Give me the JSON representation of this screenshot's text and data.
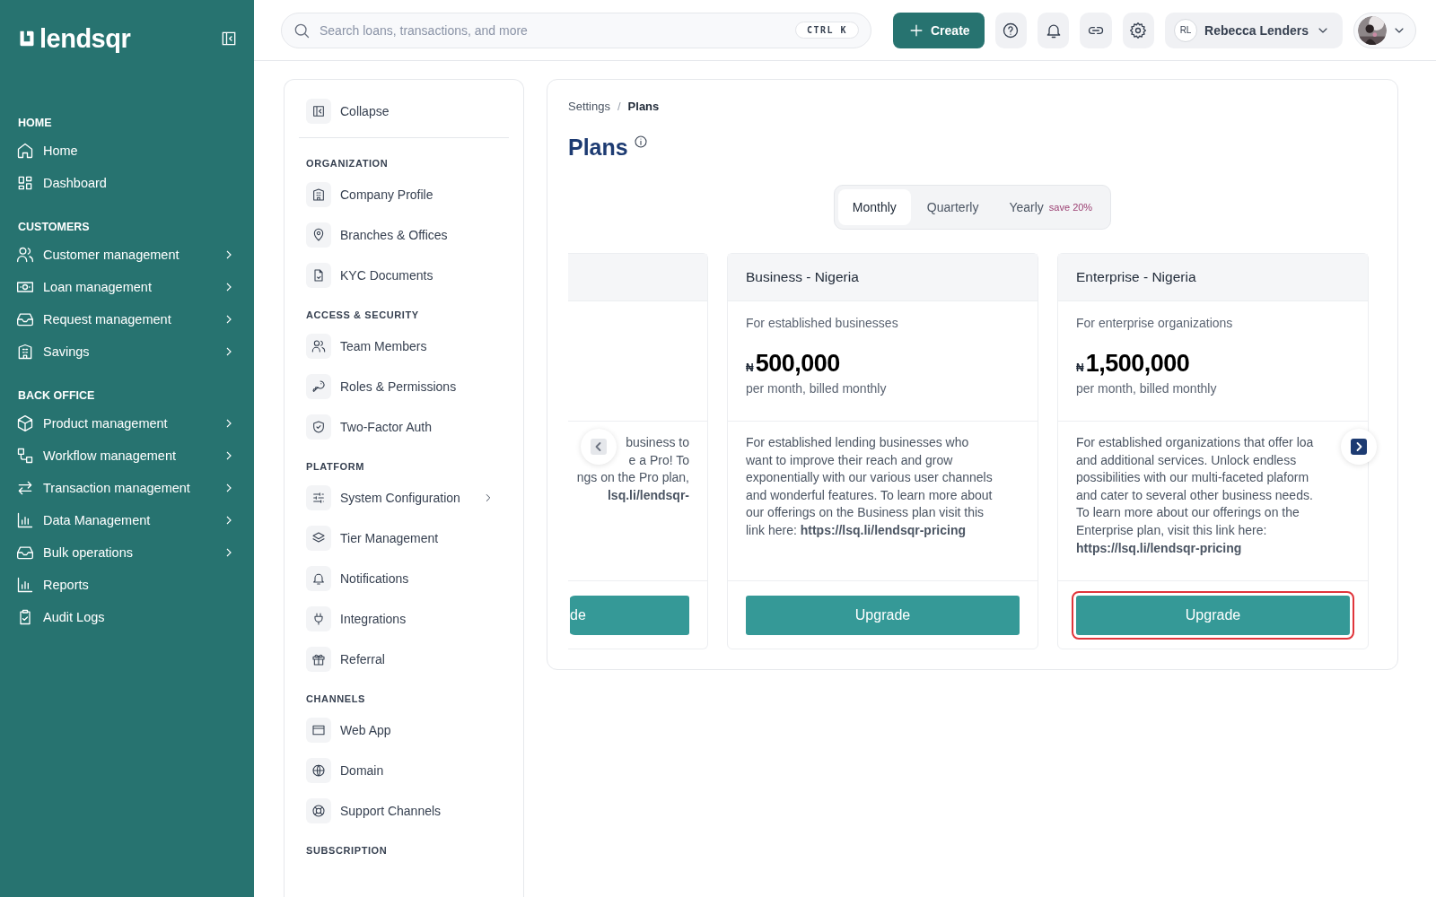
{
  "sidebar": {
    "logo": "lendsqr",
    "sections": [
      {
        "heading": "HOME",
        "items": [
          {
            "label": "Home",
            "expandable": false
          },
          {
            "label": "Dashboard",
            "expandable": false
          }
        ]
      },
      {
        "heading": "CUSTOMERS",
        "items": [
          {
            "label": "Customer management",
            "expandable": true
          },
          {
            "label": "Loan management",
            "expandable": true
          },
          {
            "label": "Request management",
            "expandable": true
          },
          {
            "label": "Savings",
            "expandable": true
          }
        ]
      },
      {
        "heading": "BACK OFFICE",
        "items": [
          {
            "label": "Product management",
            "expandable": true
          },
          {
            "label": "Workflow management",
            "expandable": true
          },
          {
            "label": "Transaction management",
            "expandable": true
          },
          {
            "label": "Data Management",
            "expandable": true
          },
          {
            "label": "Bulk operations",
            "expandable": true
          },
          {
            "label": "Reports",
            "expandable": false
          },
          {
            "label": "Audit Logs",
            "expandable": false
          }
        ]
      }
    ]
  },
  "topbar": {
    "search": {
      "placeholder": "Search loans, transactions, and more",
      "shortcut": "CTRL K"
    },
    "create_button": "Create",
    "user": {
      "initials": "RL",
      "name": "Rebecca Lenders"
    }
  },
  "settings_menu": {
    "collapse": "Collapse",
    "sections": [
      {
        "heading": "ORGANIZATION",
        "items": [
          {
            "label": "Company Profile",
            "expandable": false
          },
          {
            "label": "Branches & Offices",
            "expandable": false
          },
          {
            "label": "KYC Documents",
            "expandable": false
          }
        ]
      },
      {
        "heading": "ACCESS & SECURITY",
        "items": [
          {
            "label": "Team Members",
            "expandable": false
          },
          {
            "label": "Roles & Permissions",
            "expandable": false
          },
          {
            "label": "Two-Factor Auth",
            "expandable": false
          }
        ]
      },
      {
        "heading": "PLATFORM",
        "items": [
          {
            "label": "System Configuration",
            "expandable": true
          },
          {
            "label": "Tier Management",
            "expandable": false
          },
          {
            "label": "Notifications",
            "expandable": false
          },
          {
            "label": "Integrations",
            "expandable": false
          },
          {
            "label": "Referral",
            "expandable": false
          }
        ]
      },
      {
        "heading": "CHANNELS",
        "items": [
          {
            "label": "Web App",
            "expandable": false
          },
          {
            "label": "Domain",
            "expandable": false
          },
          {
            "label": "Support Channels",
            "expandable": false
          }
        ]
      },
      {
        "heading": "SUBSCRIPTION"
      }
    ]
  },
  "main": {
    "breadcrumb": [
      "Settings",
      "Plans"
    ],
    "breadcrumb_separator": "/",
    "title": "Plans",
    "billing_tabs": [
      {
        "label": "Monthly",
        "selected": true
      },
      {
        "label": "Quarterly",
        "selected": false
      },
      {
        "label": "Yearly",
        "badge": "save 20%",
        "selected": false
      }
    ],
    "carousel": {
      "prev_disabled": true,
      "next_disabled": false
    },
    "plans": [
      {
        "kind": "partial",
        "lines": [
          "business to",
          "e a Pro! To",
          "ngs on the Pro plan,",
          "**lsq.li/lendsqr-**"
        ],
        "button": "de",
        "focused": false
      },
      {
        "kind": "full",
        "name": "Business - Nigeria",
        "subtitle": "For established businesses",
        "currency": "₦",
        "price": "500,000",
        "period": "per month, billed monthly",
        "description": "For established lending businesses who want to improve their reach and grow exponentially with our various user channels and wonderful features. To learn more about our offerings on the Business plan visit this link here: **https://lsq.li/lendsqr-pricing**",
        "button": "Upgrade",
        "focused": false
      },
      {
        "kind": "full",
        "name": "Enterprise - Nigeria",
        "subtitle": "For enterprise organizations",
        "currency": "₦",
        "price": "1,500,000",
        "period": "per month, billed monthly",
        "description": "For established organizations that offer loa and additional services. Unlock endless possibilities with our multi-faceted plaform and cater to several other business needs. To learn more about our offerings on the Enterprise plan, visit this link here: **https://lsq.li/lendsqr-pricing**",
        "button": "Upgrade",
        "focused": true
      }
    ]
  }
}
